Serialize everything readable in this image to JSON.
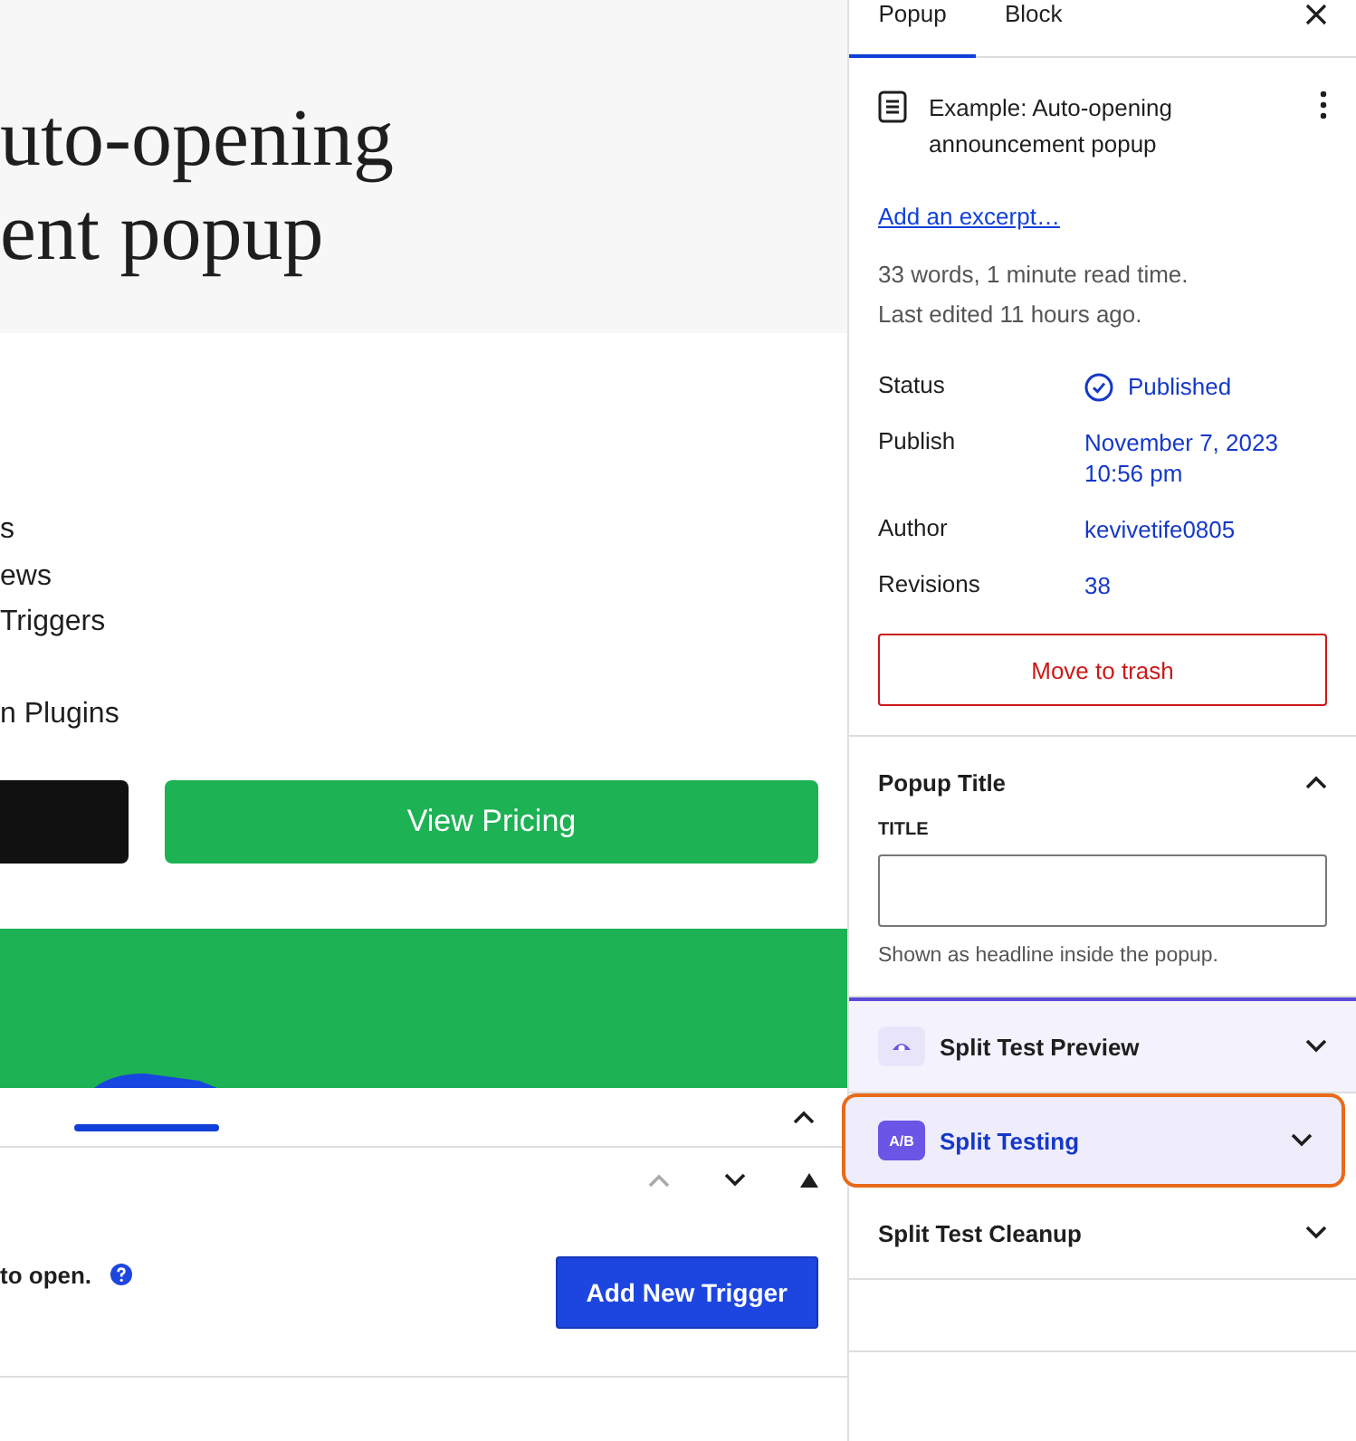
{
  "editor": {
    "heading_lines": [
      "uto-opening",
      "ent popup"
    ],
    "list_groups": [
      [
        "s",
        "ews",
        "Triggers"
      ],
      [
        "n Plugins"
      ]
    ],
    "buttons": [
      {
        "kind": "dark"
      },
      {
        "kind": "primary",
        "label": "View Pricing"
      }
    ],
    "triggers": {
      "description": "to open.",
      "add_button": "Add New Trigger"
    }
  },
  "sidebar": {
    "tabs": [
      {
        "label": "Popup",
        "selected": true
      },
      {
        "label": "Block",
        "selected": false
      }
    ],
    "post_title": "Example: Auto-opening announcement popup",
    "excerpt_link": "Add an excerpt…",
    "stats": [
      "33 words, 1 minute read time.",
      "Last edited 11 hours ago."
    ],
    "fields": [
      {
        "label": "Status",
        "value": "Published",
        "kind": "status"
      },
      {
        "label": "Publish",
        "value": "November 7, 2023 10:56 pm",
        "kind": "link"
      },
      {
        "label": "Author",
        "value": "kevivetife0805",
        "kind": "link"
      },
      {
        "label": "Revisions",
        "value": "38",
        "kind": "link"
      }
    ],
    "trash_button": "Move to trash",
    "sections": [
      {
        "title": "Popup Title",
        "expanded": true,
        "highlighted": false,
        "kind": "plain",
        "field_label": "TITLE",
        "help": "Shown as headline inside the popup."
      },
      {
        "title": "Split Test Preview",
        "expanded": false,
        "highlighted": false,
        "kind": "eye"
      },
      {
        "title": "Split Testing",
        "expanded": false,
        "highlighted": true,
        "kind": "ab",
        "icon_text": "A/B"
      },
      {
        "title": "Split Test Cleanup",
        "expanded": false,
        "highlighted": false,
        "kind": "plain"
      }
    ]
  }
}
